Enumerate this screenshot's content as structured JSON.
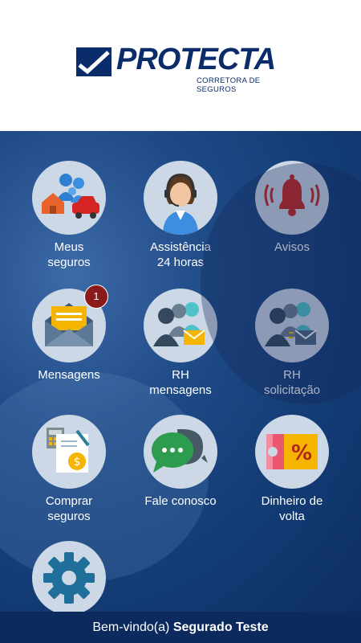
{
  "brand": {
    "name": "PROTECTA",
    "tagline": "CORRETORA DE SEGUROS"
  },
  "tiles": [
    {
      "label": "Meus\nseguros"
    },
    {
      "label": "Assistência\n24 horas"
    },
    {
      "label": "Avisos"
    },
    {
      "label": "Mensagens",
      "badge": "1"
    },
    {
      "label": "RH\nmensagens"
    },
    {
      "label": "RH\nsolicitação"
    },
    {
      "label": "Comprar\nseguros"
    },
    {
      "label": "Fale conosco"
    },
    {
      "label": "Dinheiro de\nvolta"
    },
    {
      "label": ""
    }
  ],
  "footer": {
    "greeting": "Bem-vindo(a)",
    "user": "Segurado Teste"
  },
  "colors": {
    "brand": "#0b2c6b",
    "background": "#1e4a86",
    "circle": "#ccd8e6",
    "badge": "#8b1b1b"
  }
}
